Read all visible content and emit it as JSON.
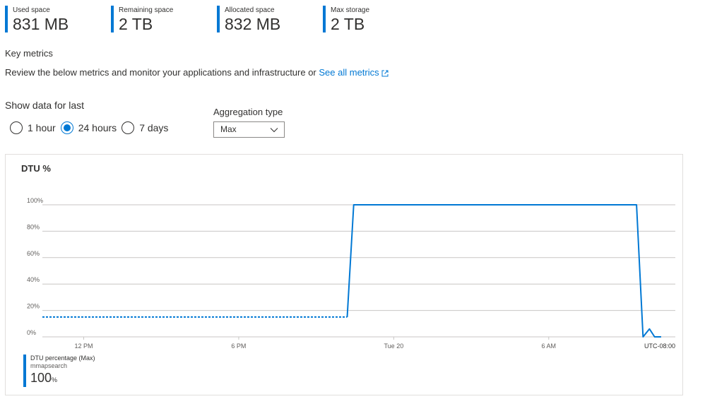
{
  "stats": [
    {
      "label": "Used space",
      "value": "831 MB"
    },
    {
      "label": "Remaining space",
      "value": "2 TB"
    },
    {
      "label": "Allocated space",
      "value": "832 MB"
    },
    {
      "label": "Max storage",
      "value": "2 TB"
    }
  ],
  "key_metrics": {
    "heading": "Key metrics",
    "description": "Review the below metrics and monitor your applications and infrastructure or",
    "link_text": "See all metrics"
  },
  "time_range": {
    "heading": "Show data for last",
    "options": [
      "1 hour",
      "24 hours",
      "7 days"
    ],
    "selected": "24 hours"
  },
  "aggregation": {
    "label": "Aggregation type",
    "selected": "Max"
  },
  "colors": {
    "accent": "#0078d4"
  },
  "chart_data": {
    "type": "line",
    "title": "DTU %",
    "y_ticks": [
      "100%",
      "80%",
      "60%",
      "40%",
      "20%",
      "0%"
    ],
    "ylim": [
      0,
      100
    ],
    "x_ticks": [
      "12 PM",
      "6 PM",
      "Tue 20",
      "6 AM",
      "UTC-08:00"
    ],
    "x_hours_range": [
      -1.6,
      22.9
    ],
    "series": [
      {
        "name": "DTU percentage (Max)",
        "style": "dashed",
        "points": [
          [
            -1.6,
            15
          ],
          [
            10.2,
            15
          ]
        ]
      },
      {
        "name": "DTU percentage (Max)",
        "style": "solid",
        "points": [
          [
            10.2,
            15
          ],
          [
            10.45,
            100
          ],
          [
            21.4,
            100
          ],
          [
            21.65,
            0
          ],
          [
            21.9,
            6
          ],
          [
            22.1,
            0
          ],
          [
            22.35,
            0
          ]
        ]
      }
    ],
    "legend": {
      "series_label": "DTU percentage (Max)",
      "resource": "mmapsearch",
      "value": "100",
      "unit": "%"
    }
  }
}
